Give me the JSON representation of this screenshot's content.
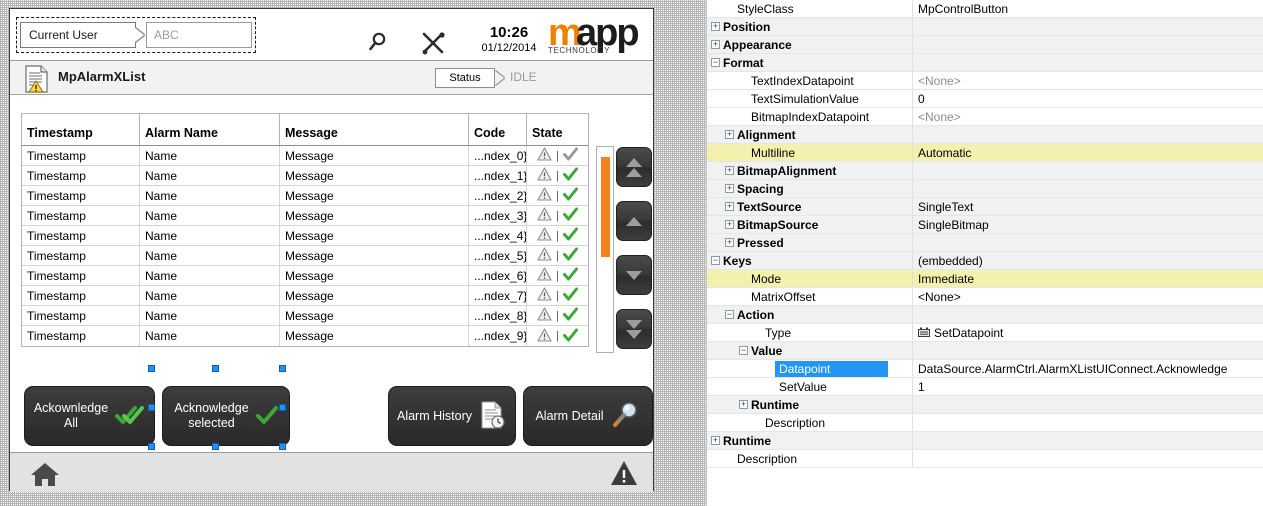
{
  "hmi": {
    "header": {
      "user_label": "Current User",
      "user_value": "ABC",
      "search_icon": "search-icon",
      "tools_icon": "tools-icon",
      "time": "10:26",
      "date": "01/12/2014",
      "logo_m": "m",
      "logo_app": "app",
      "logo_tech": "TECHNOLOGY",
      "logo_orange": "#f08000"
    },
    "title": {
      "text": "MpAlarmXList",
      "status_label": "Status",
      "status_value": "IDLE"
    },
    "table": {
      "columns": [
        "Timestamp",
        "Alarm Name",
        "Message",
        "Code",
        "State"
      ],
      "rows": [
        {
          "timestamp": "Timestamp",
          "name": "Name",
          "message": "Message",
          "code": "...ndex_0}",
          "ack": "gray"
        },
        {
          "timestamp": "Timestamp",
          "name": "Name",
          "message": "Message",
          "code": "...ndex_1}",
          "ack": "green"
        },
        {
          "timestamp": "Timestamp",
          "name": "Name",
          "message": "Message",
          "code": "...ndex_2}",
          "ack": "green"
        },
        {
          "timestamp": "Timestamp",
          "name": "Name",
          "message": "Message",
          "code": "...ndex_3}",
          "ack": "green"
        },
        {
          "timestamp": "Timestamp",
          "name": "Name",
          "message": "Message",
          "code": "...ndex_4}",
          "ack": "green"
        },
        {
          "timestamp": "Timestamp",
          "name": "Name",
          "message": "Message",
          "code": "...ndex_5}",
          "ack": "green"
        },
        {
          "timestamp": "Timestamp",
          "name": "Name",
          "message": "Message",
          "code": "...ndex_6}",
          "ack": "green"
        },
        {
          "timestamp": "Timestamp",
          "name": "Name",
          "message": "Message",
          "code": "...ndex_7}",
          "ack": "green"
        },
        {
          "timestamp": "Timestamp",
          "name": "Name",
          "message": "Message",
          "code": "...ndex_8}",
          "ack": "green"
        },
        {
          "timestamp": "Timestamp",
          "name": "Name",
          "message": "Message",
          "code": "...ndex_9}",
          "ack": "green"
        }
      ],
      "scroll_thumb_color": "#f58220"
    },
    "nav_buttons": [
      {
        "name": "scroll-top-button",
        "icon": "double-up-icon"
      },
      {
        "name": "scroll-up-button",
        "icon": "up-icon"
      },
      {
        "name": "scroll-down-button",
        "icon": "down-icon"
      },
      {
        "name": "scroll-bottom-button",
        "icon": "double-down-icon"
      }
    ],
    "buttons": {
      "ack_all_line1": "Ackownledge",
      "ack_all_line2": "All",
      "ack_sel_line1": "Acknowledge",
      "ack_sel_line2": "selected",
      "alarm_history": "Alarm History",
      "alarm_detail": "Alarm Detail"
    },
    "footer": {
      "home_icon": "home-icon",
      "alarm_icon": "warning-icon"
    }
  },
  "properties": {
    "rows": [
      {
        "indent": 1,
        "name": "StyleClass",
        "value": "MpControlButton",
        "bold": false,
        "group": false,
        "expander": "",
        "hl": false,
        "dim": false
      },
      {
        "indent": 0,
        "name": "Position",
        "value": "",
        "bold": true,
        "group": true,
        "expander": "+",
        "hl": false,
        "dim": false
      },
      {
        "indent": 0,
        "name": "Appearance",
        "value": "",
        "bold": true,
        "group": true,
        "expander": "+",
        "hl": false,
        "dim": false
      },
      {
        "indent": 0,
        "name": "Format",
        "value": "",
        "bold": true,
        "group": true,
        "expander": "-",
        "hl": false,
        "dim": false
      },
      {
        "indent": 2,
        "name": "TextIndexDatapoint",
        "value": "<None>",
        "bold": false,
        "group": false,
        "expander": "",
        "hl": false,
        "dim": true
      },
      {
        "indent": 2,
        "name": "TextSimulationValue",
        "value": "0",
        "bold": false,
        "group": false,
        "expander": "",
        "hl": false,
        "dim": false
      },
      {
        "indent": 2,
        "name": "BitmapIndexDatapoint",
        "value": "<None>",
        "bold": false,
        "group": false,
        "expander": "",
        "hl": false,
        "dim": true
      },
      {
        "indent": 1,
        "name": "Alignment",
        "value": "",
        "bold": true,
        "group": true,
        "expander": "+",
        "hl": false,
        "dim": false
      },
      {
        "indent": 2,
        "name": "Multiline",
        "value": "Automatic",
        "bold": false,
        "group": false,
        "expander": "",
        "hl": true,
        "dim": false
      },
      {
        "indent": 1,
        "name": "BitmapAlignment",
        "value": "",
        "bold": true,
        "group": true,
        "expander": "+",
        "hl": false,
        "dim": false
      },
      {
        "indent": 1,
        "name": "Spacing",
        "value": "",
        "bold": true,
        "group": true,
        "expander": "+",
        "hl": false,
        "dim": false
      },
      {
        "indent": 1,
        "name": "TextSource",
        "value": "SingleText",
        "bold": true,
        "group": true,
        "expander": "+",
        "hl": false,
        "dim": false
      },
      {
        "indent": 1,
        "name": "BitmapSource",
        "value": "SingleBitmap",
        "bold": true,
        "group": true,
        "expander": "+",
        "hl": false,
        "dim": false
      },
      {
        "indent": 1,
        "name": "Pressed",
        "value": "",
        "bold": true,
        "group": true,
        "expander": "+",
        "hl": false,
        "dim": false
      },
      {
        "indent": 0,
        "name": "Keys",
        "value": "(embedded)",
        "bold": true,
        "group": true,
        "expander": "-",
        "hl": false,
        "dim": false
      },
      {
        "indent": 2,
        "name": "Mode",
        "value": "Immediate",
        "bold": false,
        "group": false,
        "expander": "",
        "hl": true,
        "dim": false
      },
      {
        "indent": 2,
        "name": "MatrixOffset",
        "value": "<None>",
        "bold": false,
        "group": false,
        "expander": "",
        "hl": false,
        "dim": false
      },
      {
        "indent": 1,
        "name": "Action",
        "value": "",
        "bold": true,
        "group": true,
        "expander": "-",
        "hl": false,
        "dim": false
      },
      {
        "indent": 3,
        "name": "Type",
        "value": "SetDatapoint",
        "bold": false,
        "group": false,
        "expander": "",
        "hl": false,
        "dim": false,
        "value_icon": "datapoint-icon"
      },
      {
        "indent": 2,
        "name": "Value",
        "value": "",
        "bold": true,
        "group": true,
        "expander": "-",
        "hl": false,
        "dim": false
      },
      {
        "indent": 4,
        "name": "Datapoint",
        "value": "DataSource.AlarmCtrl.AlarmXListUIConnect.Acknowledge",
        "bold": false,
        "group": false,
        "expander": "",
        "hl": false,
        "dim": false,
        "selected": true
      },
      {
        "indent": 4,
        "name": "SetValue",
        "value": "1",
        "bold": false,
        "group": false,
        "expander": "",
        "hl": false,
        "dim": false
      },
      {
        "indent": 2,
        "name": "Runtime",
        "value": "",
        "bold": true,
        "group": true,
        "expander": "+",
        "hl": false,
        "dim": false
      },
      {
        "indent": 3,
        "name": "Description",
        "value": "",
        "bold": false,
        "group": false,
        "expander": "",
        "hl": false,
        "dim": false
      },
      {
        "indent": 0,
        "name": "Runtime",
        "value": "",
        "bold": true,
        "group": true,
        "expander": "+",
        "hl": false,
        "dim": false
      },
      {
        "indent": 1,
        "name": "Description",
        "value": "",
        "bold": false,
        "group": false,
        "expander": "",
        "hl": false,
        "dim": false
      }
    ],
    "selection_color": "#2196f3",
    "highlight_color": "#f4f0ad"
  }
}
